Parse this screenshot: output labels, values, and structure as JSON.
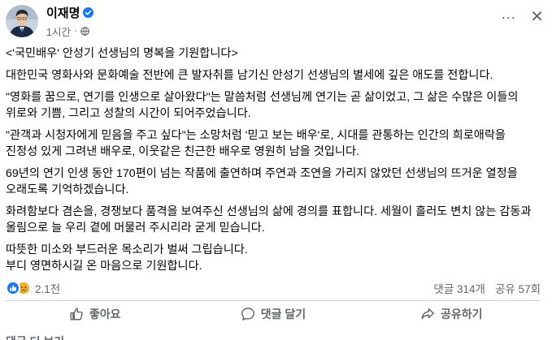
{
  "author": {
    "name": "이재명",
    "time": "1시간",
    "dot": "·",
    "verified_icon": "verified-badge-icon",
    "privacy_icon": "globe-icon"
  },
  "header_actions": {
    "more": "···",
    "close": "✕"
  },
  "post": {
    "paragraphs": [
      "<'국민배우' 안성기 선생님의 명복을 기원합니다>",
      "대한민국 영화사와 문화예술 전반에 큰 발자취를 남기신 안성기 선생님의 별세에 깊은 애도를 전합니다.",
      "\"영화를 꿈으로, 연기를 인생으로 살아왔다\"는 말씀처럼 선생님께 연기는 곧 삶이었고, 그 삶은 수많은 이들의 위로와 기쁨, 그리고 성찰의 시간이 되어주었습니다.",
      "\"관객과 시청자에게 믿음을 주고 싶다\"는 소망처럼 '믿고 보는 배우'로, 시대를 관통하는 인간의 희로애락을 진정성 있게 그려낸 배우로, 이웃같은 친근한 배우로 영원히 남을 것입니다.",
      "69년의 연기 인생 동안 170편이 넘는 작품에 출연하며 주연과 조연을 가리지 않았던 선생님의 뜨거운 열정을 오래도록 기억하겠습니다.",
      "화려함보다 겸손을, 경쟁보다 품격을 보여주신 선생님의 삶에 경의를 표합니다. 세월이 흘러도 변치 않는 감동과 울림으로 늘 우리 곁에 머물러 주시리라 굳게 믿습니다.",
      "따뜻한 미소와 부드러운 목소리가 벌써 그립습니다.",
      "부디 영면하시길 온 마음으로 기원합니다."
    ]
  },
  "stats": {
    "reaction_count": "2.1천",
    "reaction_icons": [
      "like-reaction-icon",
      "sad-reaction-icon"
    ],
    "comments": "댓글 314개",
    "shares": "공유 57회"
  },
  "actions": {
    "like": "좋아요",
    "comment": "댓글 달기",
    "share": "공유하기"
  },
  "next_hint": "댓글 더 보기",
  "colors": {
    "accent": "#1877f2",
    "sad": "#f7b125",
    "muted": "#65676b",
    "divider": "#ced0d4"
  }
}
